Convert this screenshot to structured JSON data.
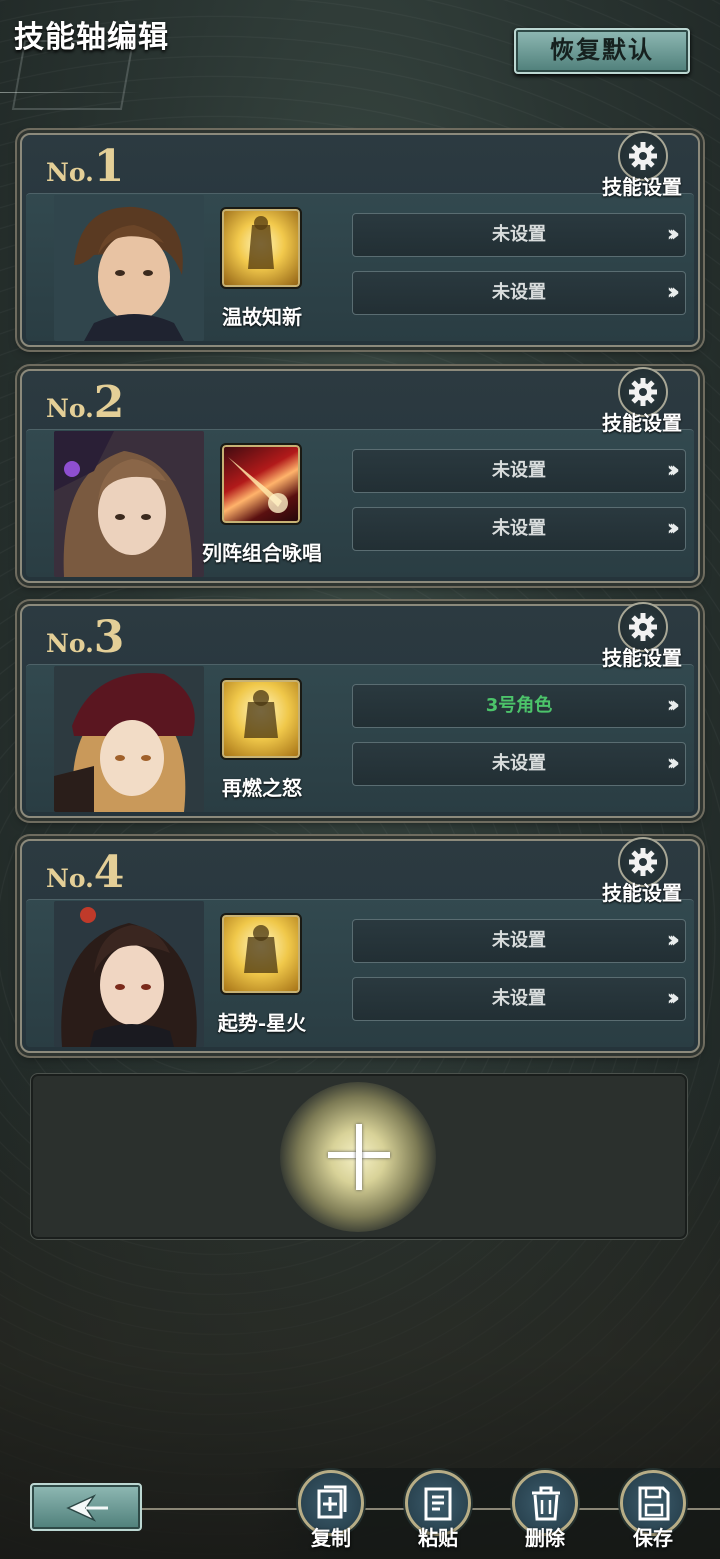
{
  "header": {
    "title": "技能轴编辑",
    "reset_label": "恢复默认"
  },
  "cards": [
    {
      "no_prefix": "No.",
      "no_num": "1",
      "gear_label": "技能设置",
      "skill_name": "温故知新",
      "slot1": "未设置",
      "slot2": "未设置"
    },
    {
      "no_prefix": "No.",
      "no_num": "2",
      "gear_label": "技能设置",
      "skill_name": "列阵组合咏唱",
      "slot1": "未设置",
      "slot2": "未设置"
    },
    {
      "no_prefix": "No.",
      "no_num": "3",
      "gear_label": "技能设置",
      "skill_name": "再燃之怒",
      "slot1": "3号角色",
      "slot2": "未设置"
    },
    {
      "no_prefix": "No.",
      "no_num": "4",
      "gear_label": "技能设置",
      "skill_name": "起势-星火",
      "slot1": "未设置",
      "slot2": "未设置"
    }
  ],
  "slot_arrow": "›››",
  "colors": {
    "accent_gold": "#e4cf97",
    "assigned_green": "#4cc36a",
    "button_teal": "#8fb9b4"
  },
  "toolbar": {
    "copy_label": "复制",
    "paste_label": "粘贴",
    "delete_label": "删除",
    "save_label": "保存"
  }
}
